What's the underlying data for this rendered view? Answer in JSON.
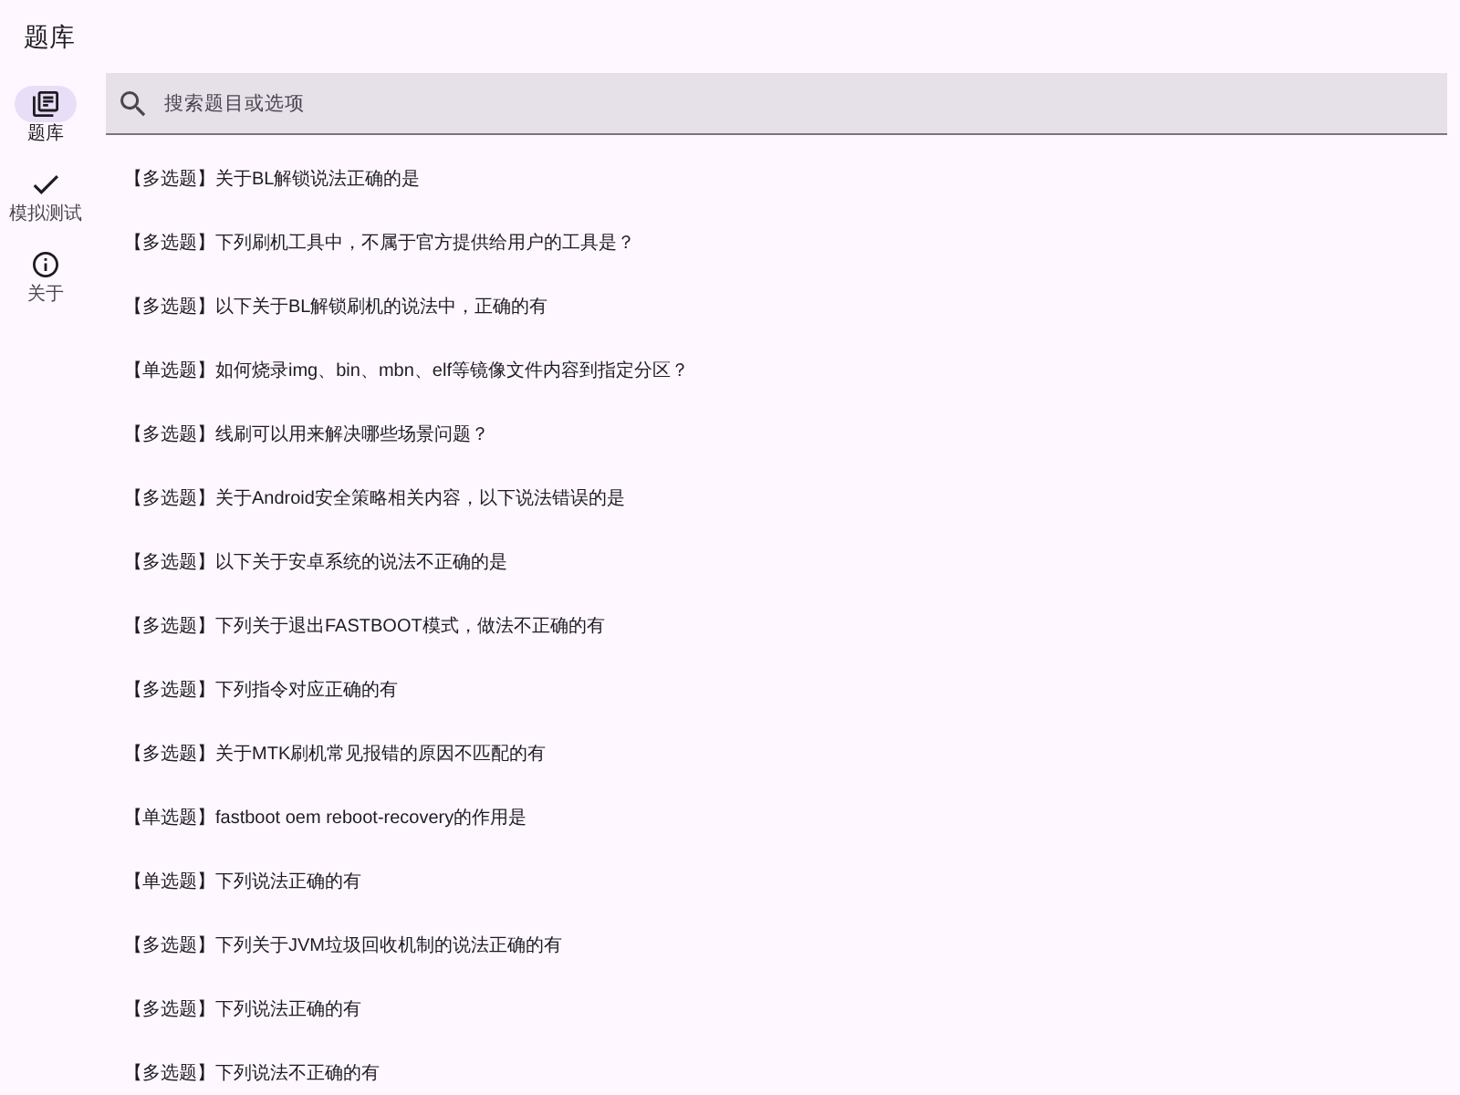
{
  "app_bar": {
    "title": "题库"
  },
  "nav_rail": [
    {
      "label": "题库",
      "selected": true
    },
    {
      "label": "模拟测试",
      "selected": false
    },
    {
      "label": "关于",
      "selected": false
    }
  ],
  "search": {
    "placeholder": "搜索题目或选项"
  },
  "questions": [
    "【多选题】关于BL解锁说法正确的是",
    "【多选题】下列刷机工具中，不属于官方提供给用户的工具是？",
    "【多选题】以下关于BL解锁刷机的说法中，正确的有",
    "【单选题】如何烧录img、bin、mbn、elf等镜像文件内容到指定分区？",
    "【多选题】线刷可以用来解决哪些场景问题？",
    "【多选题】关于Android安全策略相关内容，以下说法错误的是",
    "【多选题】以下关于安卓系统的说法不正确的是",
    "【多选题】下列关于退出FASTBOOT模式，做法不正确的有",
    "【多选题】下列指令对应正确的有",
    "【多选题】关于MTK刷机常见报错的原因不匹配的有",
    "【单选题】fastboot oem reboot-recovery的作用是",
    "【单选题】下列说法正确的有",
    "【多选题】下列关于JVM垃圾回收机制的说法正确的有",
    "【多选题】下列说法正确的有",
    "【多选题】下列说法不正确的有"
  ]
}
